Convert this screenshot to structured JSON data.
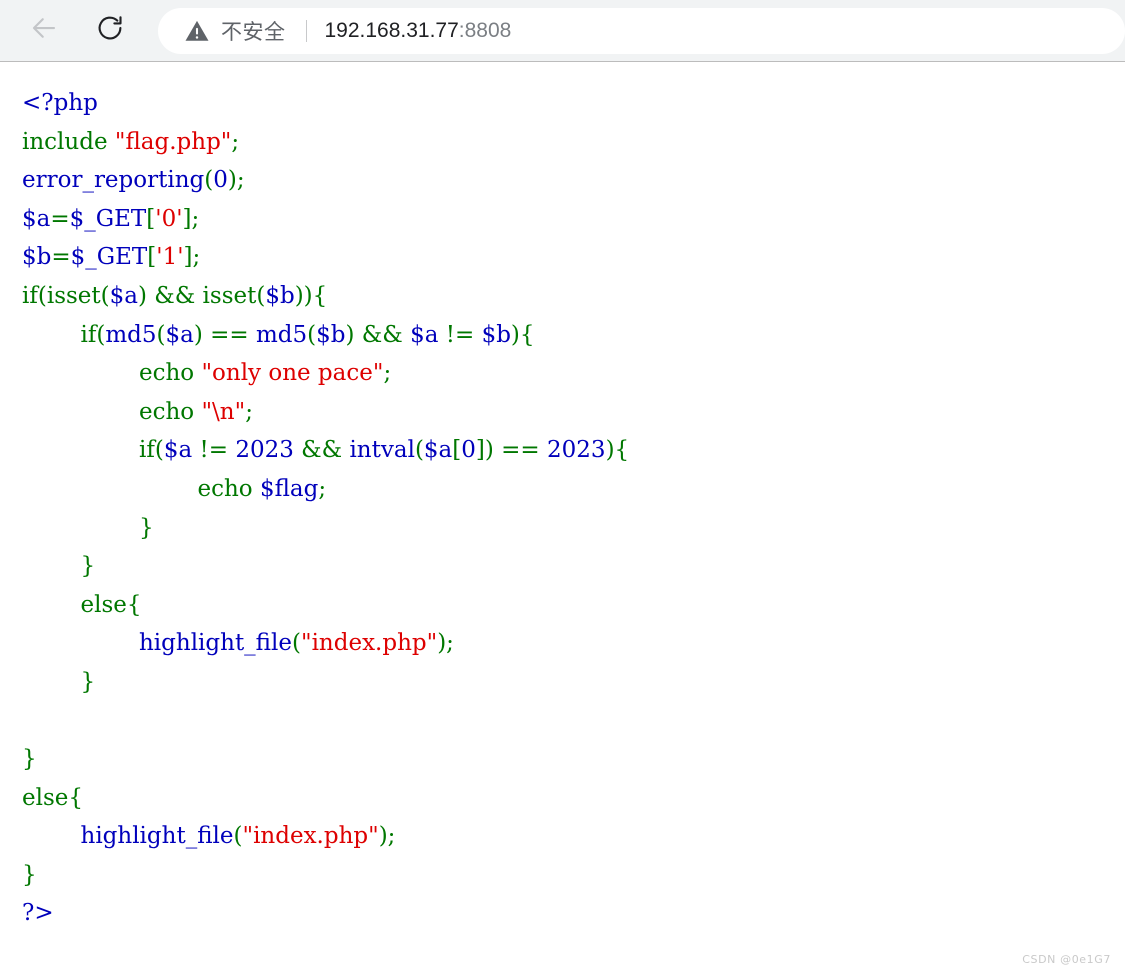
{
  "browser": {
    "back_icon": "arrow-left-icon",
    "reload_icon": "reload-icon",
    "back_enabled": false,
    "omnibox": {
      "security_icon": "warning-triangle-icon",
      "security_label": "不安全",
      "url_host": "192.168.31.77",
      "url_port": ":8808",
      "full_url": "192.168.31.77:8808"
    }
  },
  "page": {
    "language": "php",
    "source_code": "<?php\ninclude \"flag.php\";\nerror_reporting(0);\n$a=$_GET['0'];\n$b=$_GET['1'];\nif(isset($a) && isset($b)){\n        if(md5($a) == md5($b) && $a != $b){\n                echo \"only one pace\";\n                echo \"\\n\";\n                if($a != 2023 && intval($a[0]) == 2023){\n                        echo $flag;\n                }\n        }\n        else{\n                highlight_file(\"index.php\");\n        }\n\n}\nelse{\n        highlight_file(\"index.php\");\n}\n?>",
    "lines": [
      {
        "n": 1,
        "tokens": [
          {
            "t": "<?php",
            "c": "default"
          }
        ]
      },
      {
        "n": 2,
        "tokens": [
          {
            "t": "include ",
            "c": "keyword"
          },
          {
            "t": "\"flag.php\"",
            "c": "string"
          },
          {
            "t": ";",
            "c": "keyword"
          }
        ]
      },
      {
        "n": 3,
        "tokens": [
          {
            "t": "error_reporting",
            "c": "default"
          },
          {
            "t": "(",
            "c": "keyword"
          },
          {
            "t": "0",
            "c": "default"
          },
          {
            "t": ");",
            "c": "keyword"
          }
        ]
      },
      {
        "n": 4,
        "tokens": [
          {
            "t": "$a",
            "c": "default"
          },
          {
            "t": "=",
            "c": "keyword"
          },
          {
            "t": "$_GET",
            "c": "default"
          },
          {
            "t": "[",
            "c": "keyword"
          },
          {
            "t": "'0'",
            "c": "string"
          },
          {
            "t": "];",
            "c": "keyword"
          }
        ]
      },
      {
        "n": 5,
        "tokens": [
          {
            "t": "$b",
            "c": "default"
          },
          {
            "t": "=",
            "c": "keyword"
          },
          {
            "t": "$_GET",
            "c": "default"
          },
          {
            "t": "[",
            "c": "keyword"
          },
          {
            "t": "'1'",
            "c": "string"
          },
          {
            "t": "];",
            "c": "keyword"
          }
        ]
      },
      {
        "n": 6,
        "tokens": [
          {
            "t": "if(isset(",
            "c": "keyword"
          },
          {
            "t": "$a",
            "c": "default"
          },
          {
            "t": ") && isset(",
            "c": "keyword"
          },
          {
            "t": "$b",
            "c": "default"
          },
          {
            "t": ")){",
            "c": "keyword"
          }
        ]
      },
      {
        "n": 7,
        "tokens": [
          {
            "t": "        if(",
            "c": "keyword"
          },
          {
            "t": "md5",
            "c": "default"
          },
          {
            "t": "(",
            "c": "keyword"
          },
          {
            "t": "$a",
            "c": "default"
          },
          {
            "t": ") == ",
            "c": "keyword"
          },
          {
            "t": "md5",
            "c": "default"
          },
          {
            "t": "(",
            "c": "keyword"
          },
          {
            "t": "$b",
            "c": "default"
          },
          {
            "t": ") && ",
            "c": "keyword"
          },
          {
            "t": "$a",
            "c": "default"
          },
          {
            "t": " != ",
            "c": "keyword"
          },
          {
            "t": "$b",
            "c": "default"
          },
          {
            "t": "){",
            "c": "keyword"
          }
        ]
      },
      {
        "n": 8,
        "tokens": [
          {
            "t": "                echo ",
            "c": "keyword"
          },
          {
            "t": "\"only one pace\"",
            "c": "string"
          },
          {
            "t": ";",
            "c": "keyword"
          }
        ]
      },
      {
        "n": 9,
        "tokens": [
          {
            "t": "                echo ",
            "c": "keyword"
          },
          {
            "t": "\"\\n\"",
            "c": "string"
          },
          {
            "t": ";",
            "c": "keyword"
          }
        ]
      },
      {
        "n": 10,
        "tokens": [
          {
            "t": "                if(",
            "c": "keyword"
          },
          {
            "t": "$a",
            "c": "default"
          },
          {
            "t": " != ",
            "c": "keyword"
          },
          {
            "t": "2023",
            "c": "default"
          },
          {
            "t": " && ",
            "c": "keyword"
          },
          {
            "t": "intval",
            "c": "default"
          },
          {
            "t": "(",
            "c": "keyword"
          },
          {
            "t": "$a",
            "c": "default"
          },
          {
            "t": "[",
            "c": "keyword"
          },
          {
            "t": "0",
            "c": "default"
          },
          {
            "t": "]) == ",
            "c": "keyword"
          },
          {
            "t": "2023",
            "c": "default"
          },
          {
            "t": "){",
            "c": "keyword"
          }
        ]
      },
      {
        "n": 11,
        "tokens": [
          {
            "t": "                        echo ",
            "c": "keyword"
          },
          {
            "t": "$flag",
            "c": "default"
          },
          {
            "t": ";",
            "c": "keyword"
          }
        ]
      },
      {
        "n": 12,
        "tokens": [
          {
            "t": "                }",
            "c": "keyword"
          }
        ]
      },
      {
        "n": 13,
        "tokens": [
          {
            "t": "        }",
            "c": "keyword"
          }
        ]
      },
      {
        "n": 14,
        "tokens": [
          {
            "t": "        else{",
            "c": "keyword"
          }
        ]
      },
      {
        "n": 15,
        "tokens": [
          {
            "t": "                ",
            "c": "keyword"
          },
          {
            "t": "highlight_file",
            "c": "default"
          },
          {
            "t": "(",
            "c": "keyword"
          },
          {
            "t": "\"index.php\"",
            "c": "string"
          },
          {
            "t": ");",
            "c": "keyword"
          }
        ]
      },
      {
        "n": 16,
        "tokens": [
          {
            "t": "        }",
            "c": "keyword"
          }
        ]
      },
      {
        "n": 17,
        "tokens": [
          {
            "t": "",
            "c": "keyword"
          }
        ]
      },
      {
        "n": 18,
        "tokens": [
          {
            "t": "}",
            "c": "keyword"
          }
        ]
      },
      {
        "n": 19,
        "tokens": [
          {
            "t": "else{",
            "c": "keyword"
          }
        ]
      },
      {
        "n": 20,
        "tokens": [
          {
            "t": "        ",
            "c": "keyword"
          },
          {
            "t": "highlight_file",
            "c": "default"
          },
          {
            "t": "(",
            "c": "keyword"
          },
          {
            "t": "\"index.php\"",
            "c": "string"
          },
          {
            "t": ");",
            "c": "keyword"
          }
        ]
      },
      {
        "n": 21,
        "tokens": [
          {
            "t": "}",
            "c": "keyword"
          }
        ]
      },
      {
        "n": 22,
        "tokens": [
          {
            "t": "?>",
            "c": "default"
          }
        ]
      }
    ],
    "watermark": "CSDN @0e1G7"
  },
  "colors": {
    "php_default": "#0000BB",
    "php_keyword": "#007700",
    "php_string": "#DD0000",
    "toolbar_bg": "#f1f3f4",
    "omnibox_bg": "#ffffff",
    "page_bg": "#ffffff",
    "security_text": "#5f6368",
    "url_host": "#202124",
    "url_port": "#7b7f84"
  }
}
